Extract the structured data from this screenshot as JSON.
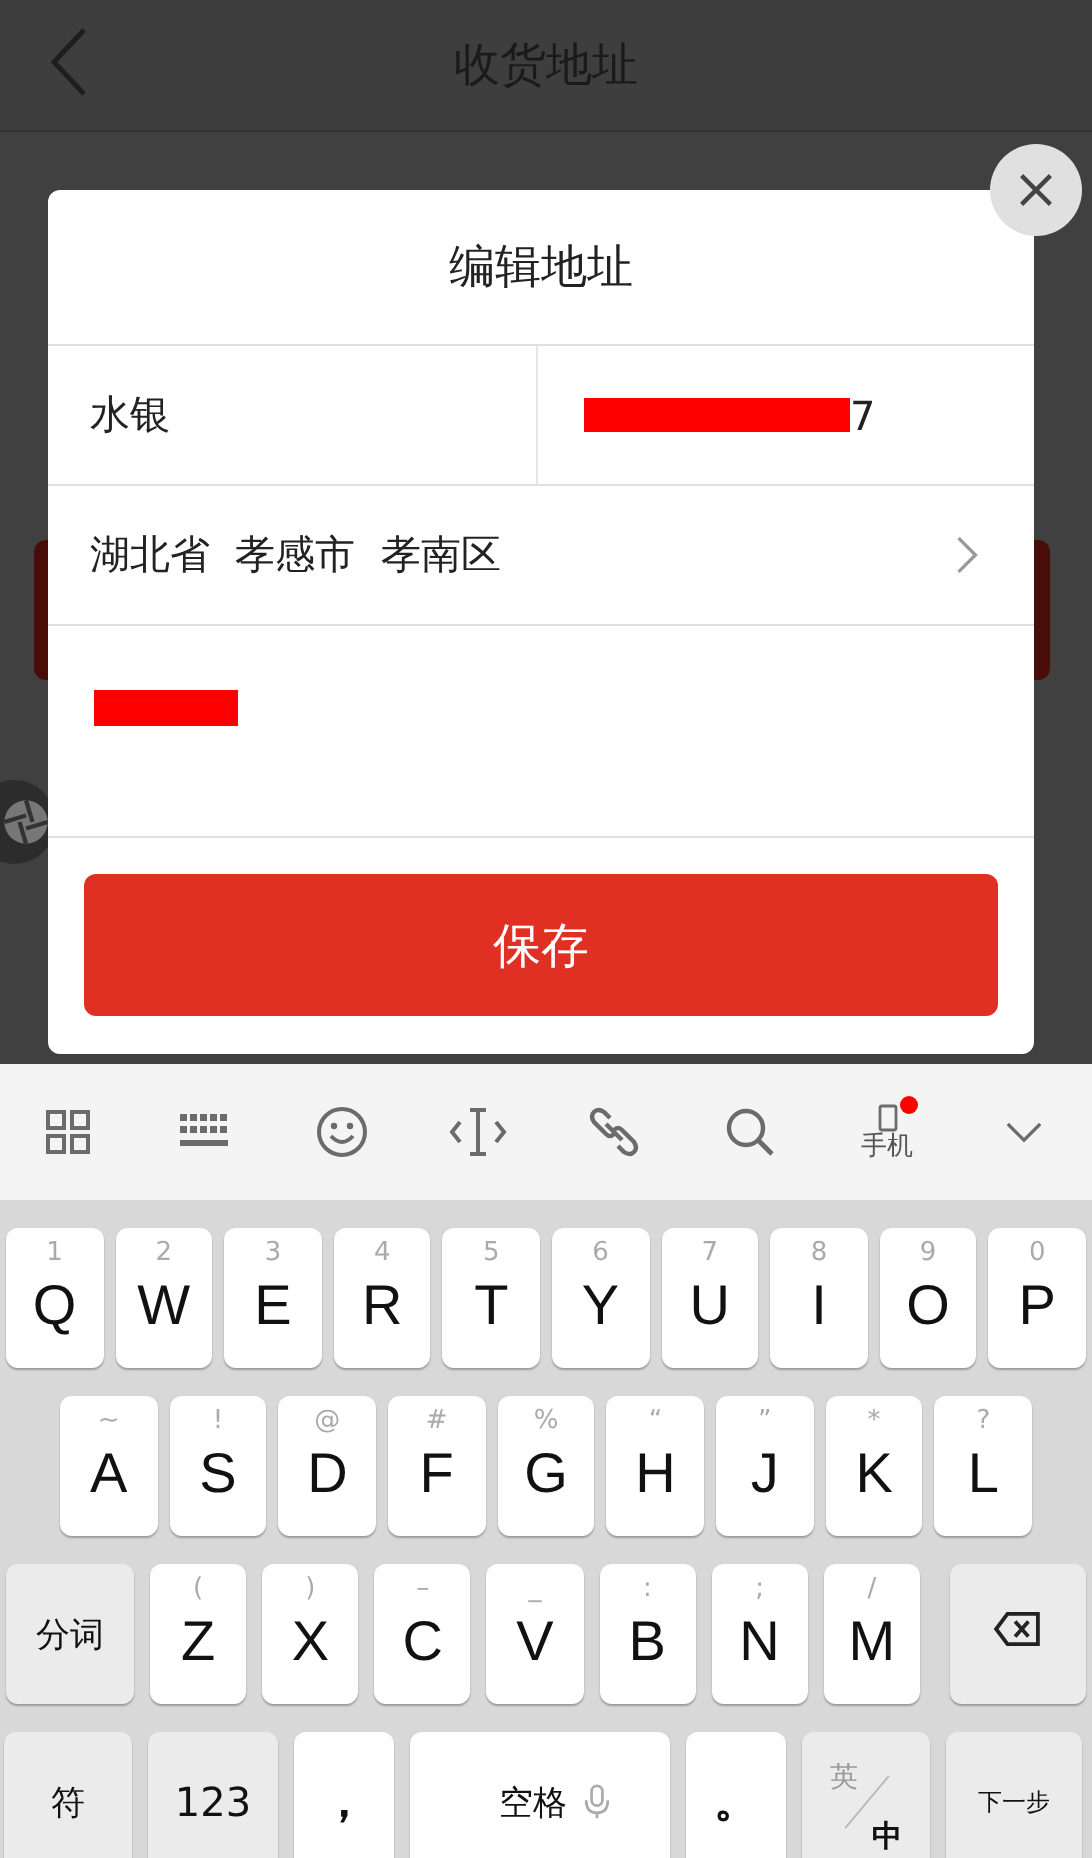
{
  "header": {
    "title": "收货地址"
  },
  "dialog": {
    "title": "编辑地址",
    "name": "水银",
    "phone": "7",
    "phone_redacted": true,
    "address_redacted": true,
    "region": "湖北省  孝感市  孝南区",
    "save_button": "保存"
  },
  "keyboard": {
    "toolbar": [
      {
        "kind": "grid"
      },
      {
        "kind": "keyboard"
      },
      {
        "kind": "emoji"
      },
      {
        "kind": "cursor"
      },
      {
        "kind": "link"
      },
      {
        "kind": "search"
      },
      {
        "kind": "phone",
        "label": "手机",
        "notification": true
      },
      {
        "kind": "collapse"
      }
    ],
    "rows": [
      {
        "keys": [
          {
            "kind": "letter",
            "label": "Q",
            "hint": "1"
          },
          {
            "kind": "letter",
            "label": "W",
            "hint": "2"
          },
          {
            "kind": "letter",
            "label": "E",
            "hint": "3"
          },
          {
            "kind": "letter",
            "label": "R",
            "hint": "4"
          },
          {
            "kind": "letter",
            "label": "T",
            "hint": "5"
          },
          {
            "kind": "letter",
            "label": "Y",
            "hint": "6"
          },
          {
            "kind": "letter",
            "label": "U",
            "hint": "7"
          },
          {
            "kind": "letter",
            "label": "I",
            "hint": "8"
          },
          {
            "kind": "letter",
            "label": "O",
            "hint": "9"
          },
          {
            "kind": "letter",
            "label": "P",
            "hint": "0"
          }
        ]
      },
      {
        "keys": [
          {
            "kind": "letter",
            "label": "A",
            "hint": "~"
          },
          {
            "kind": "letter",
            "label": "S",
            "hint": "!"
          },
          {
            "kind": "letter",
            "label": "D",
            "hint": "@"
          },
          {
            "kind": "letter",
            "label": "F",
            "hint": "#"
          },
          {
            "kind": "letter",
            "label": "G",
            "hint": "%"
          },
          {
            "kind": "letter",
            "label": "H",
            "hint": "“"
          },
          {
            "kind": "letter",
            "label": "J",
            "hint": "”"
          },
          {
            "kind": "letter",
            "label": "K",
            "hint": "*"
          },
          {
            "kind": "letter",
            "label": "L",
            "hint": "?"
          }
        ]
      },
      {
        "keys": [
          {
            "kind": "function",
            "label": "分词"
          },
          {
            "kind": "letter",
            "label": "Z",
            "hint": "("
          },
          {
            "kind": "letter",
            "label": "X",
            "hint": ")"
          },
          {
            "kind": "letter",
            "label": "C",
            "hint": "–"
          },
          {
            "kind": "letter",
            "label": "V",
            "hint": "_"
          },
          {
            "kind": "letter",
            "label": "B",
            "hint": ":"
          },
          {
            "kind": "letter",
            "label": "N",
            "hint": ";"
          },
          {
            "kind": "letter",
            "label": "M",
            "hint": "/"
          },
          {
            "kind": "delete"
          }
        ]
      },
      {
        "keys": [
          {
            "kind": "function",
            "label": "符"
          },
          {
            "kind": "function",
            "label": "123"
          },
          {
            "kind": "punct",
            "label": "，"
          },
          {
            "kind": "space",
            "label": "空格"
          },
          {
            "kind": "punct",
            "label": "。"
          },
          {
            "kind": "lang",
            "label": "英",
            "alt": "中"
          },
          {
            "kind": "next",
            "label": "下一步"
          }
        ]
      }
    ]
  }
}
